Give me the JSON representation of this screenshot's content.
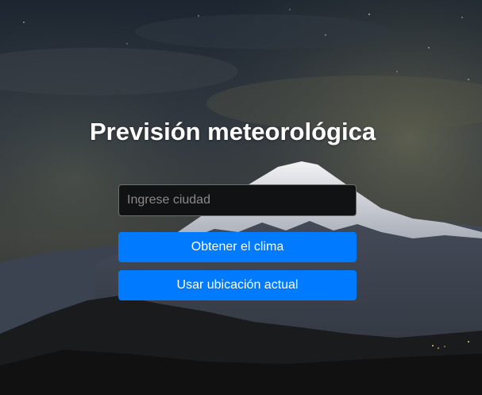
{
  "page": {
    "title": "Previsión meteorológica"
  },
  "form": {
    "city_placeholder": "Ingrese ciudad",
    "city_value": "",
    "get_weather_label": "Obtener el clima",
    "use_location_label": "Usar ubicación actual"
  },
  "colors": {
    "accent": "#007bff",
    "input_background": "#111214",
    "title_text": "#ffffff"
  },
  "background": {
    "scene": "night-sky-snowcapped-mountain"
  }
}
